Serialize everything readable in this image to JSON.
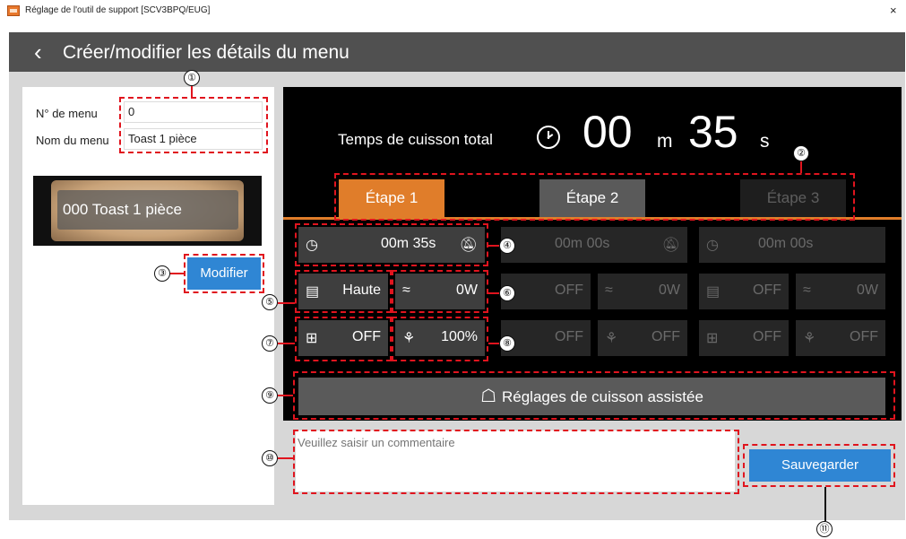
{
  "window": {
    "title": "Réglage de l'outil de support [SCV3BPQ/EUG]",
    "close": "×"
  },
  "header": {
    "back_icon": "chevron-left-icon",
    "title": "Créer/modifier les détails du menu"
  },
  "menu": {
    "number_label": "N° de menu",
    "number_value": "0",
    "name_label": "Nom du menu",
    "name_value": "Toast 1 pièce",
    "thumbnail_label": "000 Toast 1 pièce",
    "modify_button": "Modifier"
  },
  "total": {
    "label": "Temps de cuisson total",
    "minutes": "00",
    "m_unit": "m",
    "seconds": "35",
    "s_unit": "s"
  },
  "tabs": [
    {
      "label": "Étape 1",
      "state": "active"
    },
    {
      "label": "Étape 2",
      "state": "normal"
    },
    {
      "label": "Étape 3",
      "state": "disabled"
    }
  ],
  "steps": [
    {
      "time": "00m 35s",
      "top": "Haute",
      "micro": "0W",
      "bottom": "OFF",
      "fan": "100%",
      "enabled": true
    },
    {
      "time": "00m 00s",
      "top": "OFF",
      "micro": "0W",
      "bottom": "OFF",
      "fan": "OFF",
      "enabled": false
    },
    {
      "time": "00m 00s",
      "top": "OFF",
      "micro": "0W",
      "bottom": "OFF",
      "fan": "OFF",
      "enabled": false
    }
  ],
  "assist_button": "Réglages de cuisson assistée",
  "comment": {
    "placeholder": "Veuillez saisir un commentaire"
  },
  "save_button": "Sauvegarder",
  "callouts": [
    "①",
    "②",
    "③",
    "④",
    "⑤",
    "⑥",
    "⑦",
    "⑧",
    "⑨",
    "⑩",
    "⑪"
  ],
  "colors": {
    "accent_orange": "#e07d2a",
    "button_blue": "#2f86d4",
    "callout_red": "#e0141e",
    "header": "#505050"
  },
  "icons": [
    "clock-icon",
    "bell-off-icon",
    "top-heater-icon",
    "microwave-icon",
    "bottom-heater-icon",
    "fan-icon",
    "chef-hat-icon"
  ]
}
